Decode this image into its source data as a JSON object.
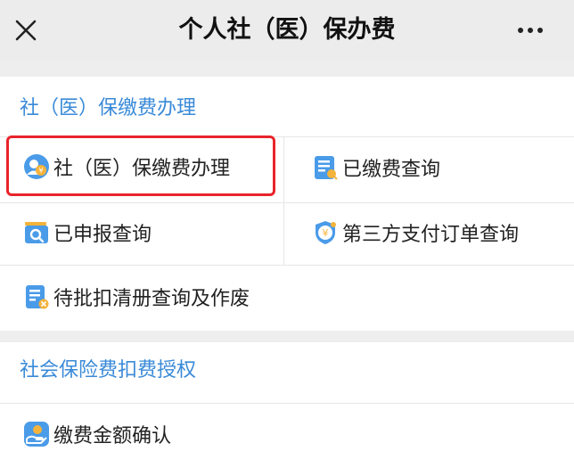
{
  "header": {
    "title": "个人社（医）保办费",
    "close_icon": "close-icon",
    "more_icon": "more-icon"
  },
  "section1": {
    "title": "社（医）保缴费办理",
    "items": [
      {
        "label": "社（医）保缴费办理",
        "icon": "payment-person-icon"
      },
      {
        "label": "已缴费查询",
        "icon": "document-search-icon"
      },
      {
        "label": "已申报查询",
        "icon": "folder-search-icon"
      },
      {
        "label": "第三方支付订单查询",
        "icon": "yuan-shield-icon"
      },
      {
        "label": "待批扣清册查询及作废",
        "icon": "document-cancel-icon"
      }
    ]
  },
  "section2": {
    "title": "社会保险费扣费授权",
    "items": [
      {
        "label": "缴费金额确认",
        "icon": "hand-coin-icon"
      }
    ]
  },
  "colors": {
    "accent": "#3a8ad8",
    "highlight": "#e8242a",
    "background": "#eeeeee"
  }
}
